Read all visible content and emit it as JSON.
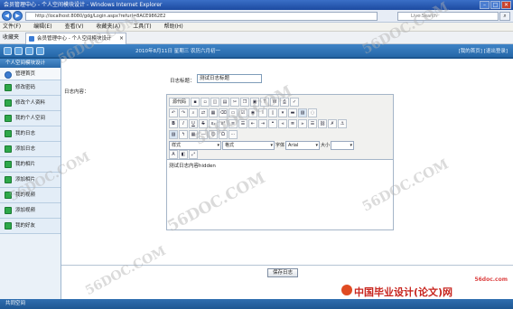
{
  "window": {
    "title": "会员管理中心 - 个人空间模块设计 - Windows Internet Explorer"
  },
  "browser": {
    "url": "http://localhost:8080/gdg/Login.aspx?refurl=8ACE9862E2",
    "search_placeholder": "Live Search",
    "menu": [
      "文件(F)",
      "编辑(E)",
      "查看(V)",
      "收藏夹(A)",
      "工具(T)",
      "帮助(H)"
    ],
    "favorites_label": "收藏夹",
    "tab_label": "会员管理中心 - 个人空间模块设计"
  },
  "header": {
    "date_text": "2010年8月11日 星期三 农历六月初一",
    "links_text": "[我的首页] [退出登录]"
  },
  "sidebar": {
    "title": "个人空间模块设计",
    "items": [
      {
        "label": "管理首页"
      },
      {
        "label": "修改密码"
      },
      {
        "label": "修改个人资料"
      },
      {
        "label": "我的个人空间"
      },
      {
        "label": "我的日志"
      },
      {
        "label": "添加日志"
      },
      {
        "label": "我的相片"
      },
      {
        "label": "添加相片"
      },
      {
        "label": "我的视频"
      },
      {
        "label": "添加视频"
      },
      {
        "label": "我的好友"
      }
    ]
  },
  "form": {
    "title_label": "日志标题：",
    "title_value": "测试日志标题",
    "content_label": "日志内容：",
    "source_button": "源代码",
    "style_select": "样式",
    "format_select": "格式",
    "font_label": "字体",
    "font_select": "Arial",
    "size_label": "大小",
    "editor_text": "测试日志内容hidden",
    "save_button": "保存日志"
  },
  "footer": {
    "label": "共同空间"
  },
  "branding": {
    "site": "56doc.com",
    "name": "中国毕业设计(论文)网"
  },
  "watermarks": [
    "56DOC.COM",
    "56DOC.COM",
    "56DOC.COM",
    "56DOC.COM",
    "56DOC.COM",
    "56DOC.COM",
    "56DOC.COM"
  ]
}
